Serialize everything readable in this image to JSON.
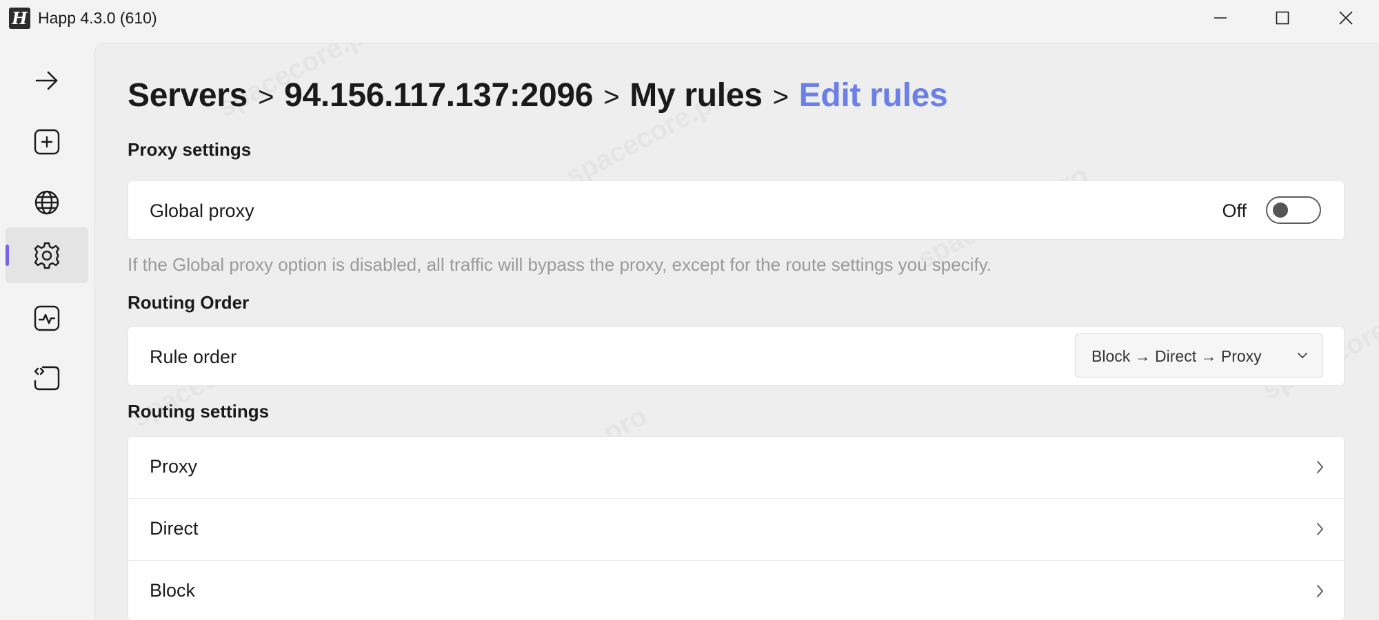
{
  "window": {
    "title": "Happ 4.3.0 (610)",
    "logo_letter": "H"
  },
  "sidebar": {
    "items": [
      {
        "icon": "arrow-right-icon",
        "active": false
      },
      {
        "icon": "add-icon",
        "active": false
      },
      {
        "icon": "globe-icon",
        "active": false
      },
      {
        "icon": "gear-icon",
        "active": true
      },
      {
        "icon": "activity-icon",
        "active": false
      },
      {
        "icon": "code-icon",
        "active": false
      }
    ],
    "accent_color": "#7a63e8"
  },
  "breadcrumb": {
    "items": [
      "Servers",
      "94.156.117.137:2096",
      "My rules"
    ],
    "separator": ">",
    "current": "Edit rules",
    "current_color": "#6b7fe8"
  },
  "proxy_settings": {
    "title": "Proxy settings",
    "global_proxy": {
      "label": "Global proxy",
      "state_text": "Off",
      "enabled": false
    },
    "hint": "If the Global proxy option is disabled, all traffic will bypass the proxy, except for the route settings you specify."
  },
  "routing_order": {
    "title": "Routing Order",
    "rule_order": {
      "label": "Rule order",
      "selected": "Block → Direct → Proxy"
    }
  },
  "routing_settings": {
    "title": "Routing settings",
    "items": [
      {
        "label": "Proxy"
      },
      {
        "label": "Direct"
      },
      {
        "label": "Block"
      }
    ]
  },
  "watermark": "spacecore.pro"
}
